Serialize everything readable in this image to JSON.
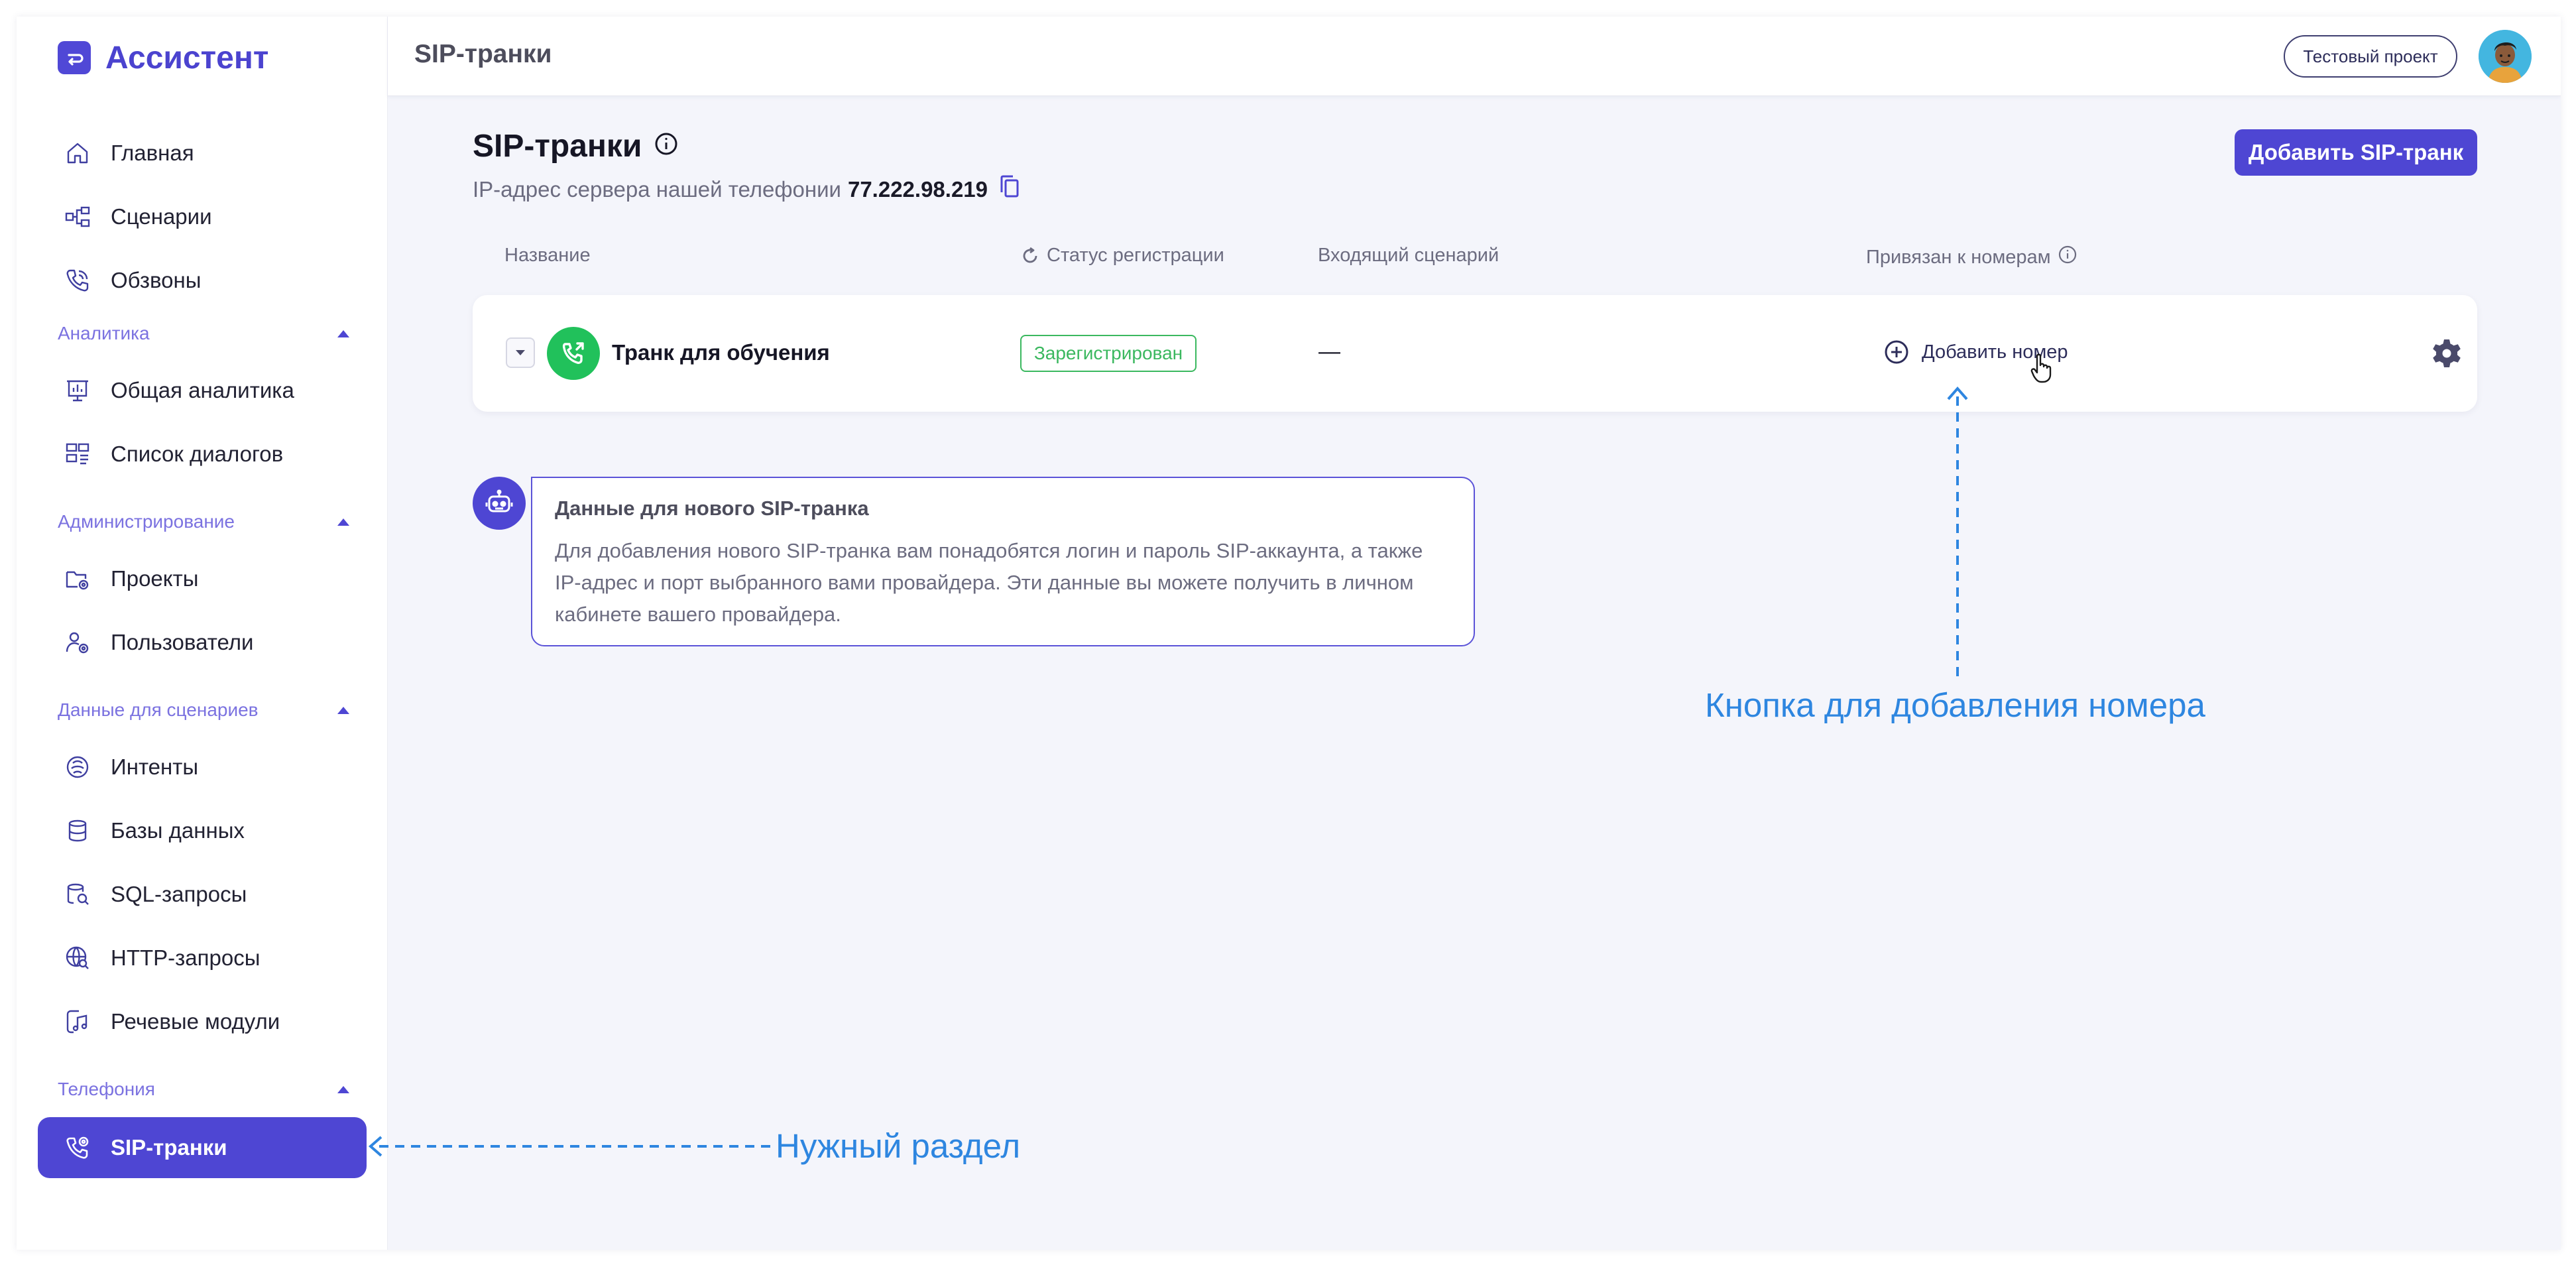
{
  "app": {
    "name": "Ассистент",
    "brand_color": "#4e46d3"
  },
  "header": {
    "title": "SIP-транки",
    "project_button": "Тестовый проект"
  },
  "sidebar": {
    "items": [
      {
        "label": "Главная",
        "icon": "home-icon"
      },
      {
        "label": "Сценарии",
        "icon": "scenario-icon"
      },
      {
        "label": "Обзвоны",
        "icon": "call-icon"
      }
    ],
    "sections": [
      {
        "label": "Аналитика",
        "items": [
          {
            "label": "Общая аналитика",
            "icon": "analytics-icon"
          },
          {
            "label": "Список диалогов",
            "icon": "dialogs-icon"
          }
        ]
      },
      {
        "label": "Администрирование",
        "items": [
          {
            "label": "Проекты",
            "icon": "projects-icon"
          },
          {
            "label": "Пользователи",
            "icon": "users-icon"
          }
        ]
      },
      {
        "label": "Данные для сценариев",
        "items": [
          {
            "label": "Интенты",
            "icon": "intents-icon"
          },
          {
            "label": "Базы данных",
            "icon": "database-icon"
          },
          {
            "label": "SQL-запросы",
            "icon": "sql-icon"
          },
          {
            "label": "HTTP-запросы",
            "icon": "http-icon"
          },
          {
            "label": "Речевые модули",
            "icon": "speech-icon"
          }
        ]
      },
      {
        "label": "Телефония",
        "items": [
          {
            "label": "SIP-транки",
            "icon": "sip-trunk-icon",
            "active": true
          }
        ]
      }
    ]
  },
  "main": {
    "title": "SIP-транки",
    "ip_label": "IP-адрес сервера нашей телефонии",
    "ip_value": "77.222.98.219",
    "add_trunk_button": "Добавить SIP-транк",
    "columns": [
      "Название",
      "Статус регистрации",
      "Входящий сценарий",
      "Привязан к номерам"
    ],
    "trunks": [
      {
        "name": "Транк для обучения",
        "status": "Зарегистрирован",
        "incoming": "—",
        "add_number": "Добавить номер"
      }
    ],
    "tip": {
      "title": "Данные для нового SIP-транка",
      "body": "Для добавления нового SIP-транка вам понадобятся логин и пароль SIP-аккаунта, а также IP-адрес и порт выбранного вами провайдера. Эти данные вы можете получить в личном кабинете вашего провайдера."
    }
  },
  "annotations": {
    "add_number": "Кнопка для добавления номера",
    "section": "Нужный раздел"
  },
  "colors": {
    "accent": "#4e46d3",
    "success": "#21c15b",
    "annotation": "#2e86e0"
  }
}
